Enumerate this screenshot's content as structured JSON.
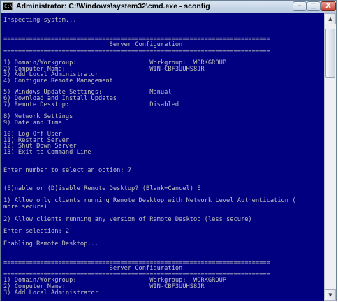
{
  "window": {
    "title": "Administrator: C:\\Windows\\system32\\cmd.exe - sconfig",
    "app_icon_text": "C:\\",
    "minimize_glyph": "–",
    "maximize_glyph": "□",
    "close_glyph": "X"
  },
  "scrollbar": {
    "up_glyph": "▲",
    "down_glyph": "▼"
  },
  "console": {
    "lines": [
      "Inspecting system...",
      "=========================================================================",
      "                             Server Configuration",
      "=========================================================================",
      "1) Domain/Workgroup:                    Workgroup:  WORKGROUP",
      "2) Computer Name:                       WIN-CBF3UUHS8JR",
      "3) Add Local Administrator",
      "4) Configure Remote Management",
      "5) Windows Update Settings:             Manual",
      "6) Download and Install Updates",
      "7) Remote Desktop:                      Disabled",
      "8) Network Settings",
      "9) Date and Time",
      "10) Log Off User",
      "11) Restart Server",
      "12) Shut Down Server",
      "13) Exit to Command Line",
      "Enter number to select an option: 7",
      "(E)nable or (D)isable Remote Desktop? (Blank=Cancel) E",
      "1) Allow only clients running Remote Desktop with Network Level Authentication (",
      "more secure)",
      "2) Allow clients running any version of Remote Desktop (less secure)",
      "Enter selection: 2",
      "Enabling Remote Desktop...",
      "=========================================================================",
      "                             Server Configuration",
      "=========================================================================",
      "1) Domain/Workgroup:                    Workgroup:  WORKGROUP",
      "2) Computer Name:                       WIN-CBF3UUHS8JR",
      "3) Add Local Administrator"
    ]
  }
}
